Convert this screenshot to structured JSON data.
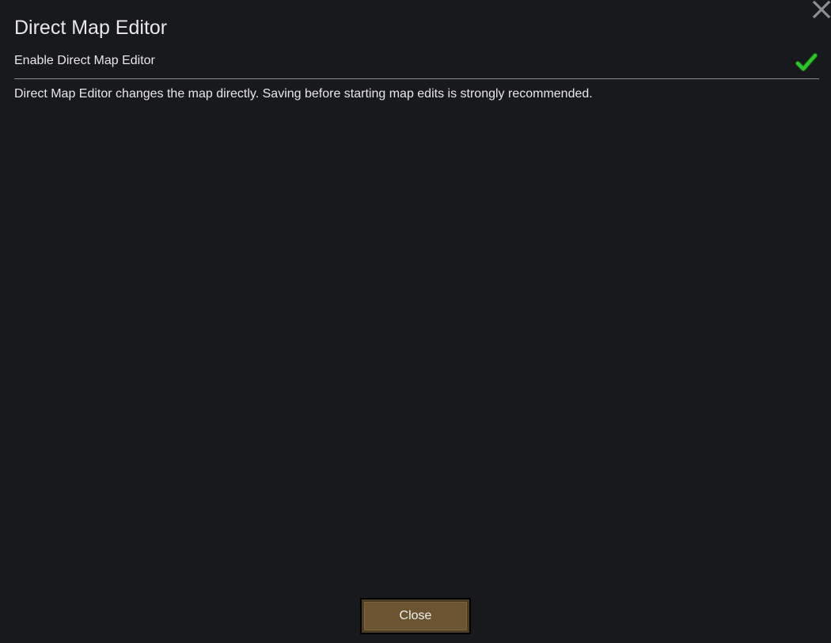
{
  "dialog": {
    "title": "Direct Map Editor",
    "close_icon": "close-x-icon"
  },
  "option": {
    "label": "Enable Direct Map Editor",
    "checked": true,
    "check_icon": "checkmark-icon",
    "check_color": "#27c52b"
  },
  "description": "Direct Map Editor changes the map directly. Saving before starting map edits is strongly recommended.",
  "footer": {
    "close_label": "Close",
    "button_color": "#6b5431"
  }
}
